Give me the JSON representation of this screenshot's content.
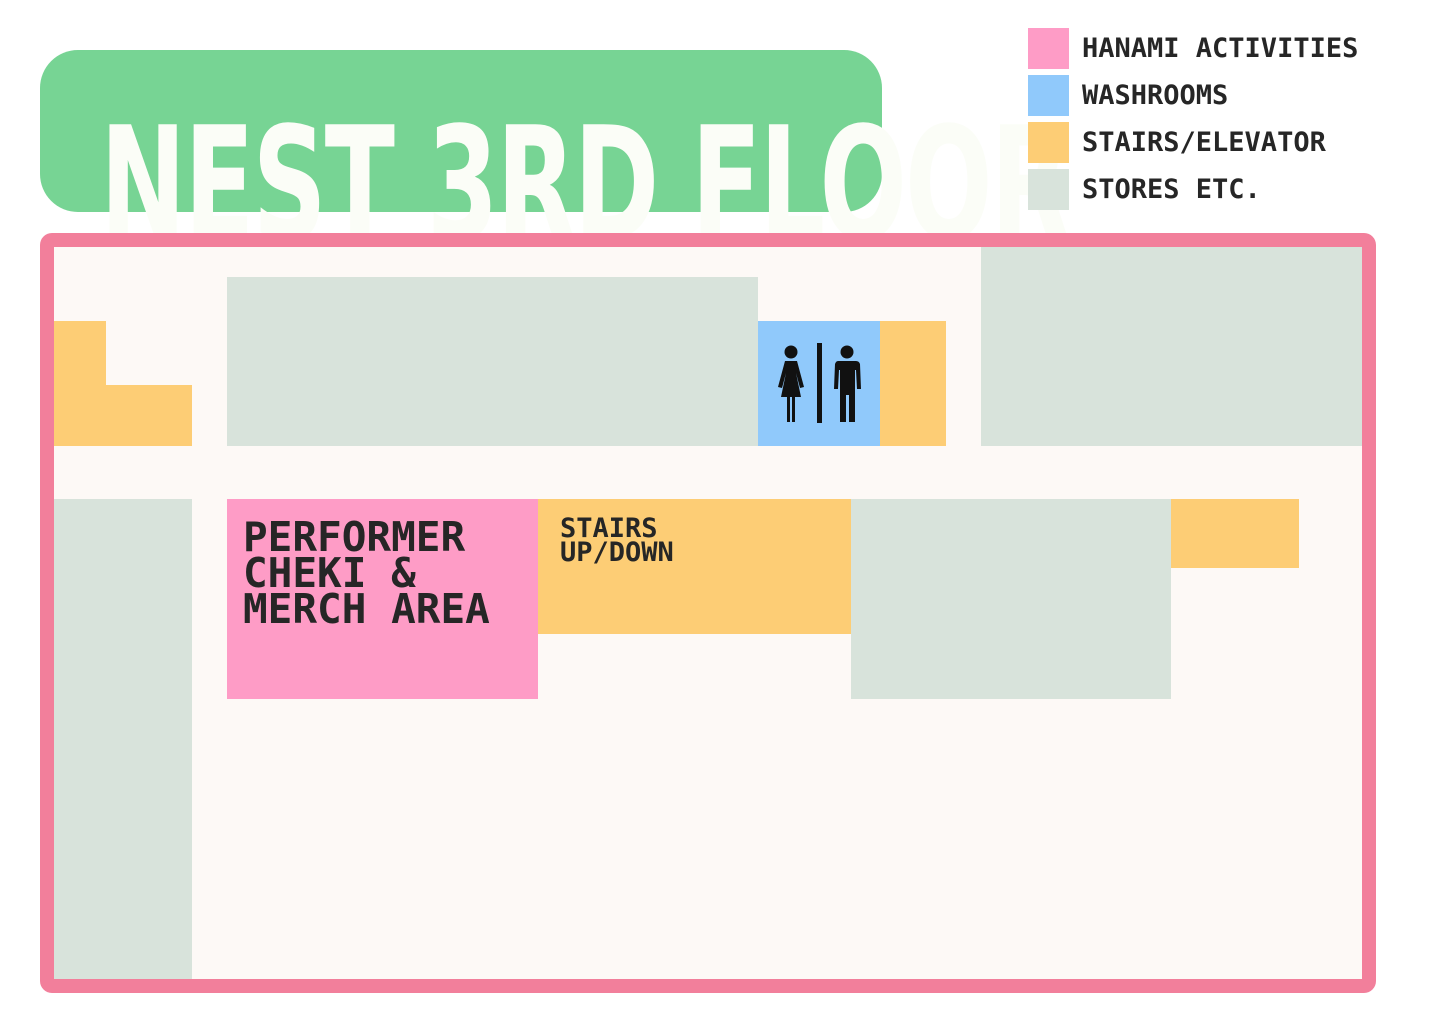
{
  "title": "NEST 3RD FLOOR",
  "legend": [
    {
      "label": "HANAMI ACTIVITIES",
      "color": "#fe9cc6"
    },
    {
      "label": "WASHROOMS",
      "color": "#90c9fb"
    },
    {
      "label": "STAIRS/ELEVATOR",
      "color": "#fdcd75"
    },
    {
      "label": "STORES ETC.",
      "color": "#d8e3db"
    }
  ],
  "map": {
    "border_color": "#f27f9b",
    "floor_color": "#fdf9f6",
    "rooms": {
      "performer_area": {
        "category": "HANAMI ACTIVITIES",
        "label_lines": [
          "PERFORMER",
          "CHEKI &",
          "MERCH AREA"
        ]
      },
      "main_stairs": {
        "category": "STAIRS/ELEVATOR",
        "label_lines": [
          "STAIRS",
          "UP/DOWN"
        ]
      },
      "washroom": {
        "category": "WASHROOMS",
        "icon": "washroom-icon"
      }
    }
  }
}
